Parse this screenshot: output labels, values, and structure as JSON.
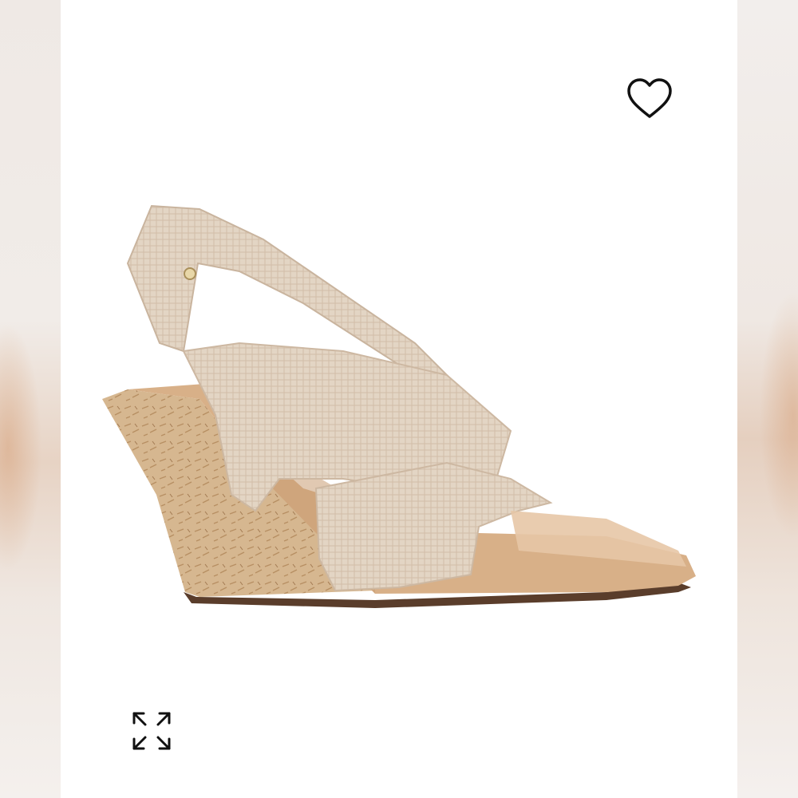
{
  "product": {
    "image_subject": "wedge-sandal",
    "colors": {
      "upper": "#e2d3c2",
      "upper_texture": "#c9b49e",
      "footbed": "#d6ae85",
      "cork": "#d4b48c",
      "sole": "#5a3d2b",
      "background_blur": "#e7d3c4"
    }
  },
  "controls": {
    "favorite_icon": "heart-outline-icon",
    "expand_icon": "expand-arrows-icon"
  }
}
